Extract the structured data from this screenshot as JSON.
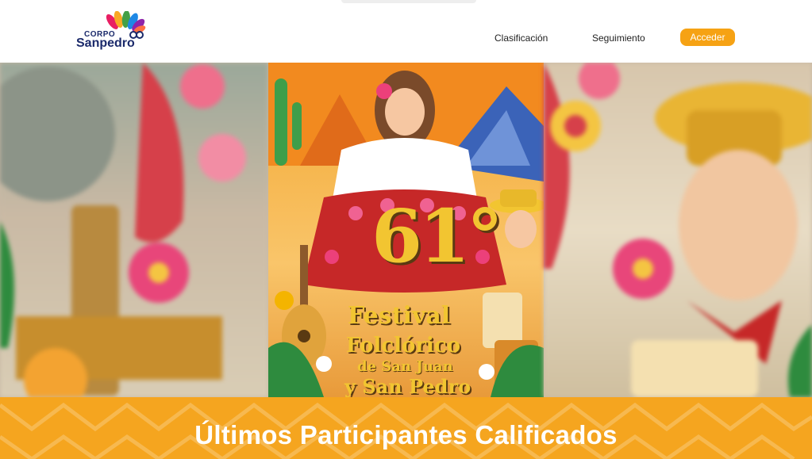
{
  "header": {
    "logo": {
      "line1": "CORPO",
      "line2": "Sanpedro"
    },
    "nav": [
      {
        "label": "Clasificación"
      },
      {
        "label": "Seguimiento"
      }
    ],
    "login_button": "Acceder"
  },
  "hero": {
    "poster": {
      "number": "61°",
      "line1": "Festival",
      "line2": "Folclórico",
      "line3": "de San Juan",
      "line4": "y San Pedro"
    }
  },
  "banner": {
    "title": "Últimos Participantes Calificados"
  },
  "colors": {
    "accent": "#f6a214",
    "banner": "#f5a51f",
    "brand_navy": "#1b2a6b"
  }
}
